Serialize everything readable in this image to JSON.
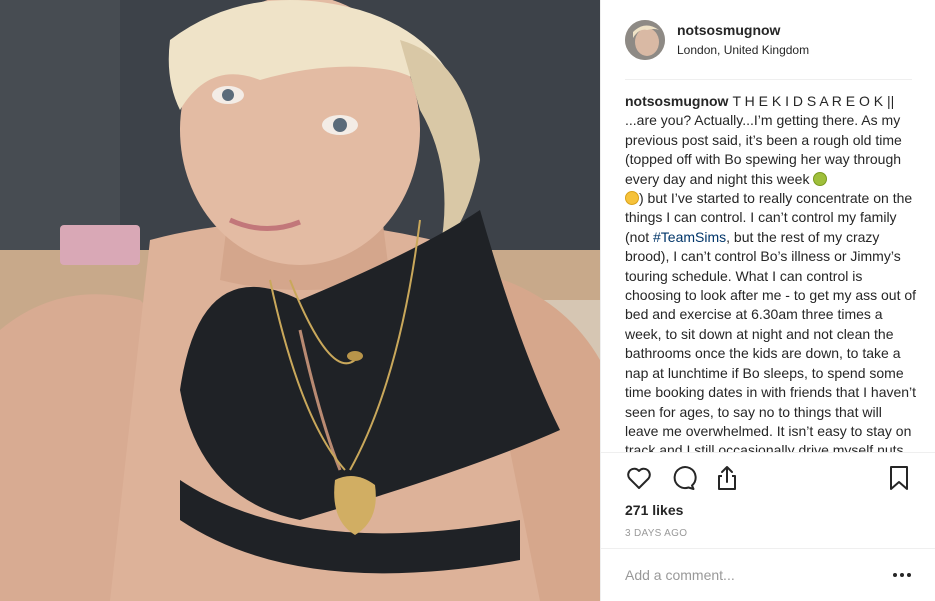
{
  "post": {
    "photo_alt": "Selfie photo",
    "header": {
      "username": "notsosmugnow",
      "location": "London, United Kingdom"
    },
    "caption": {
      "username": "notsosmugnow",
      "text_before_hashtag": "T H E K I D S A R E O K || ...are you? Actually...I’m getting there. As my previous post said, it’s been a rough old time (topped off with Bo spewing her way through every day and night this week ",
      "emoji_1": "nauseated-face-emoji",
      "emoji_2": "flushed-face-emoji",
      "text_after_emoji": ") but I’ve started to really concentrate on the things I can control. I can’t control my family (not ",
      "hashtag": "#TeamSims",
      "text_after_hashtag": ", but the rest of my crazy brood), I can’t control Bo’s illness or Jimmy’s touring schedule. What I can control is choosing to look after me - to get my ass out of bed and exercise at 6.30am three times a week, to sit down at night and not clean the bathrooms once the kids are down, to take a nap at lunchtime if Bo sleeps, to spend some time booking dates in with friends that I haven’t seen for ages, to say no to things that will leave me overwhelmed. It isn’t easy to stay on track and I still occasionally drive myself nuts"
    },
    "actions": {
      "like": "heart-icon",
      "comment": "comment-bubble-icon",
      "share": "share-upload-icon",
      "save": "bookmark-icon"
    },
    "likes": "271 likes",
    "timestamp": "3 DAYS AGO",
    "comment_placeholder": "Add a comment...",
    "more": "ellipsis-icon"
  },
  "colors": {
    "text": "#262626",
    "muted": "#999999",
    "hashtag": "#003569",
    "divider": "#efefef"
  }
}
